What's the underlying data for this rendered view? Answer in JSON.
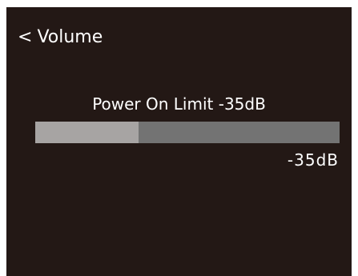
{
  "header": {
    "back_glyph": "<",
    "title": "Volume"
  },
  "setting": {
    "label": "Power On Limit -35dB",
    "value_text": "-35dB",
    "level_fraction": 0.34
  },
  "colors": {
    "background": "#231815",
    "text": "#ffffff",
    "track": "#737373",
    "fill": "#a7a4a3"
  },
  "icons": {
    "back": "chevron-left-icon"
  }
}
